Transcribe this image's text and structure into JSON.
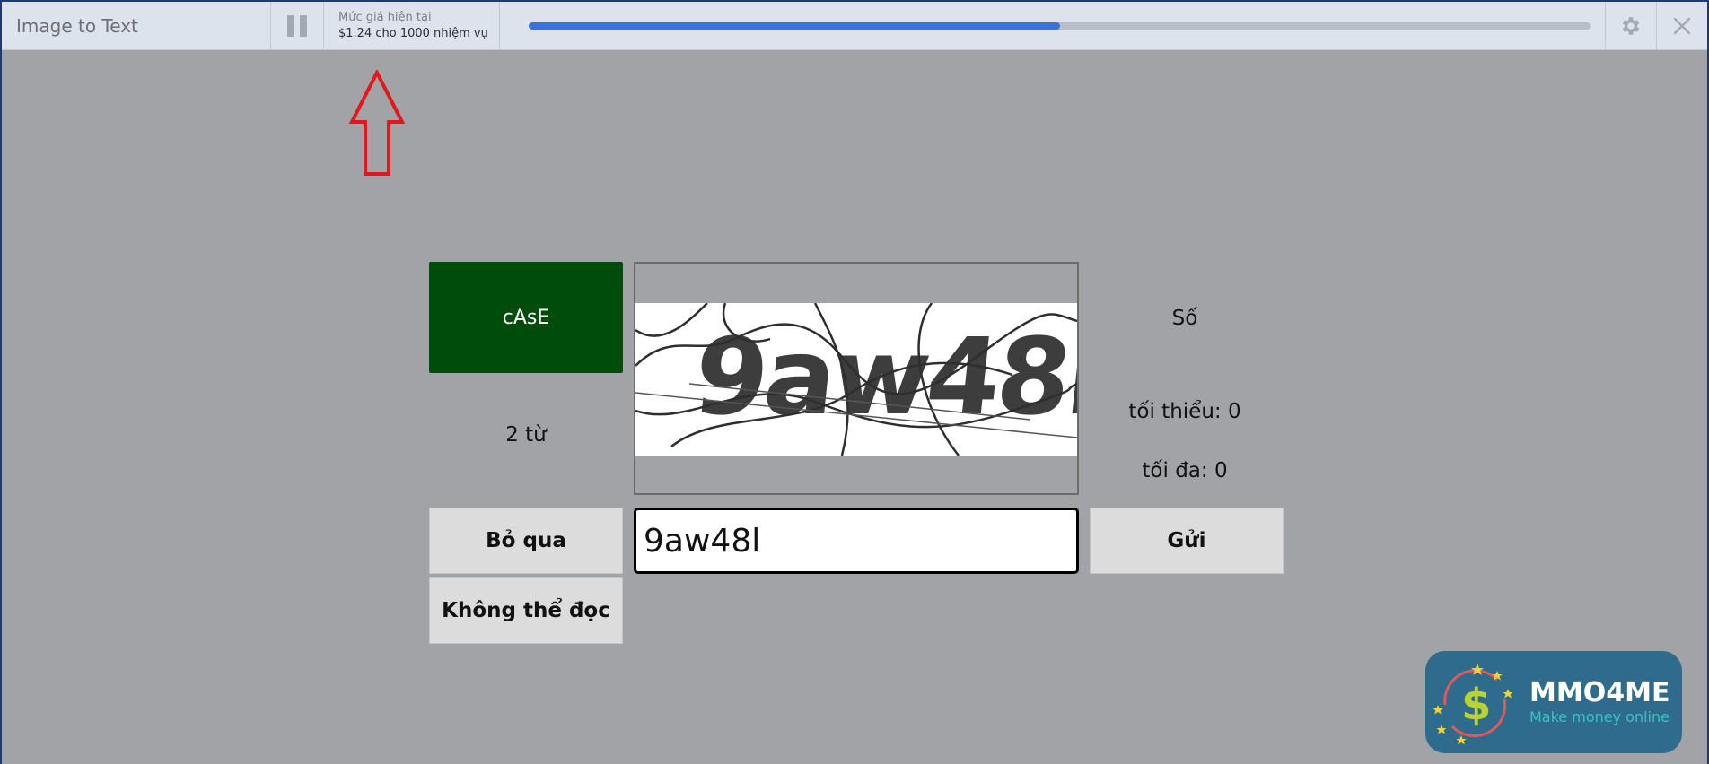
{
  "app": {
    "title": "Image to Text"
  },
  "price": {
    "label": "Mức giá hiện tại",
    "value": "$1.24 cho 1000 nhiệm vụ"
  },
  "progress": {
    "fraction": 0.5
  },
  "task": {
    "case_label": "cAsE",
    "words_label": "2 từ",
    "type_label": "Số",
    "min_label": "tối thiểu: 0",
    "max_label": "tối đa: 0",
    "captcha_text": "9aw48l",
    "answer_value": "9aw48l"
  },
  "buttons": {
    "skip": "Bỏ qua",
    "cannot_read": "Không thể đọc",
    "submit": "Gửi"
  },
  "logo": {
    "title": "MMO4ME",
    "subtitle": "Make money online"
  },
  "colors": {
    "case_bg": "#004d0b",
    "progress_fill": "#3a73d6",
    "arrow": "#e3171e",
    "logo_bg": "#2f6b8c"
  },
  "icons": [
    "pause-icon",
    "gear-icon",
    "close-icon",
    "up-arrow-icon",
    "dollar-icon"
  ]
}
